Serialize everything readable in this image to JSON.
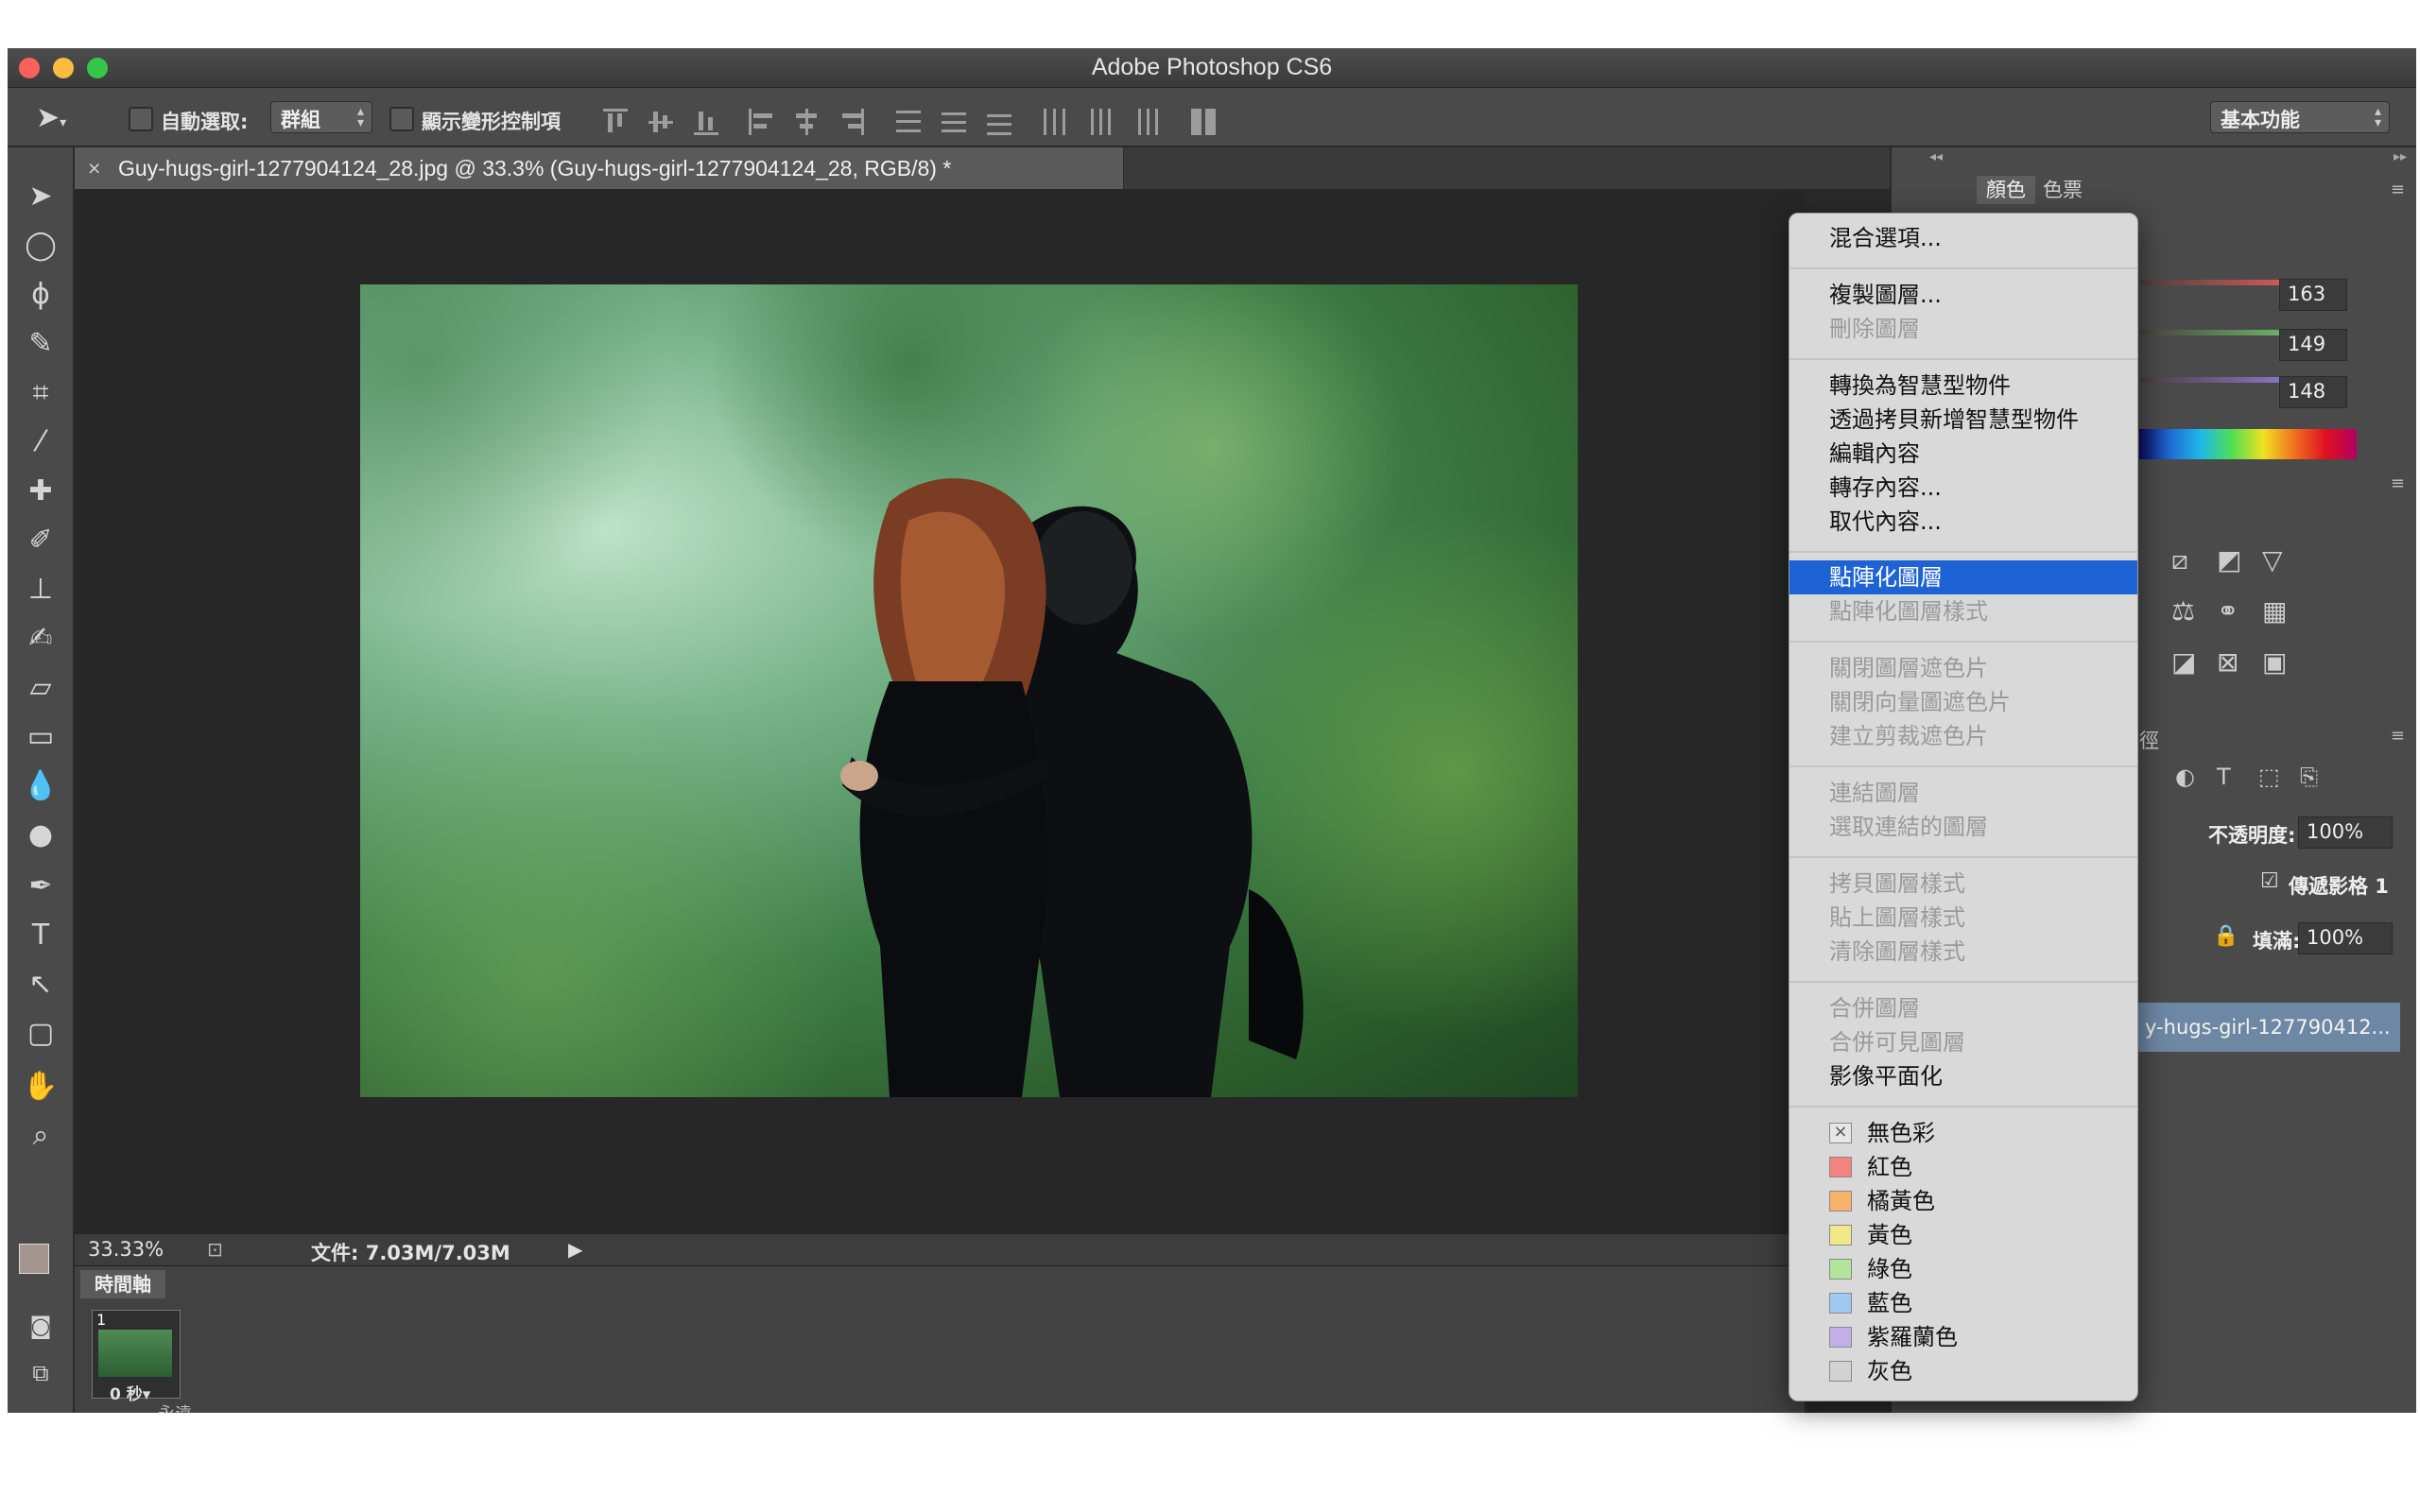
{
  "app": {
    "title": "Adobe Photoshop CS6",
    "colors": {
      "close": "#fc605c",
      "minimize": "#fdbc40",
      "zoom": "#34c84a",
      "menu_highlight": "#1e63d6"
    }
  },
  "options_bar": {
    "auto_select_label": "自動選取:",
    "auto_select_value": "群組",
    "show_transform_label": "顯示變形控制項",
    "workspace": "基本功能"
  },
  "document": {
    "tab_title": "Guy-hugs-girl-1277904124_28.jpg @ 33.3% (Guy-hugs-girl-1277904124_28, RGB/8) *",
    "zoom": "33.33%",
    "doc_size": "文件: 7.03M/7.03M"
  },
  "timeline": {
    "tab_label": "時間軸",
    "frame_number": "1",
    "frame_delay": "0 秒▾",
    "loop": "永遠"
  },
  "color_panel": {
    "tab_color": "顏色",
    "tab_swatches": "色票",
    "r": "163",
    "g": "149",
    "b": "148"
  },
  "layers_panel": {
    "tab_partial": "徑",
    "opacity_label": "不透明度:",
    "opacity": "100%",
    "fill_label": "填滿:",
    "fill": "100%",
    "propagate_label": "傳遞影格 1",
    "layer_name": "y-hugs-girl-127790412..."
  },
  "context_menu": {
    "items": [
      {
        "label": "混合選項...",
        "enabled": true
      },
      {
        "label": "複製圖層...",
        "enabled": true
      },
      {
        "label": "刪除圖層",
        "enabled": false
      },
      {
        "label": "轉換為智慧型物件",
        "enabled": true
      },
      {
        "label": "透過拷貝新增智慧型物件",
        "enabled": true
      },
      {
        "label": "編輯內容",
        "enabled": true
      },
      {
        "label": "轉存內容...",
        "enabled": true
      },
      {
        "label": "取代內容...",
        "enabled": true
      },
      {
        "label": "點陣化圖層",
        "enabled": true,
        "selected": true
      },
      {
        "label": "點陣化圖層樣式",
        "enabled": false
      },
      {
        "label": "關閉圖層遮色片",
        "enabled": false
      },
      {
        "label": "關閉向量圖遮色片",
        "enabled": false
      },
      {
        "label": "建立剪裁遮色片",
        "enabled": false
      },
      {
        "label": "連結圖層",
        "enabled": false
      },
      {
        "label": "選取連結的圖層",
        "enabled": false
      },
      {
        "label": "拷貝圖層樣式",
        "enabled": false
      },
      {
        "label": "貼上圖層樣式",
        "enabled": false
      },
      {
        "label": "清除圖層樣式",
        "enabled": false
      },
      {
        "label": "合併圖層",
        "enabled": false
      },
      {
        "label": "合併可見圖層",
        "enabled": false
      },
      {
        "label": "影像平面化",
        "enabled": true
      }
    ],
    "color_labels": [
      {
        "label": "無色彩",
        "color": "none"
      },
      {
        "label": "紅色",
        "color": "#f2837f"
      },
      {
        "label": "橘黃色",
        "color": "#f6b369"
      },
      {
        "label": "黃色",
        "color": "#efe98a"
      },
      {
        "label": "綠色",
        "color": "#b4e39b"
      },
      {
        "label": "藍色",
        "color": "#9fc8f3"
      },
      {
        "label": "紫羅蘭色",
        "color": "#c3aee8"
      },
      {
        "label": "灰色",
        "color": "#d2d2d2"
      }
    ]
  }
}
